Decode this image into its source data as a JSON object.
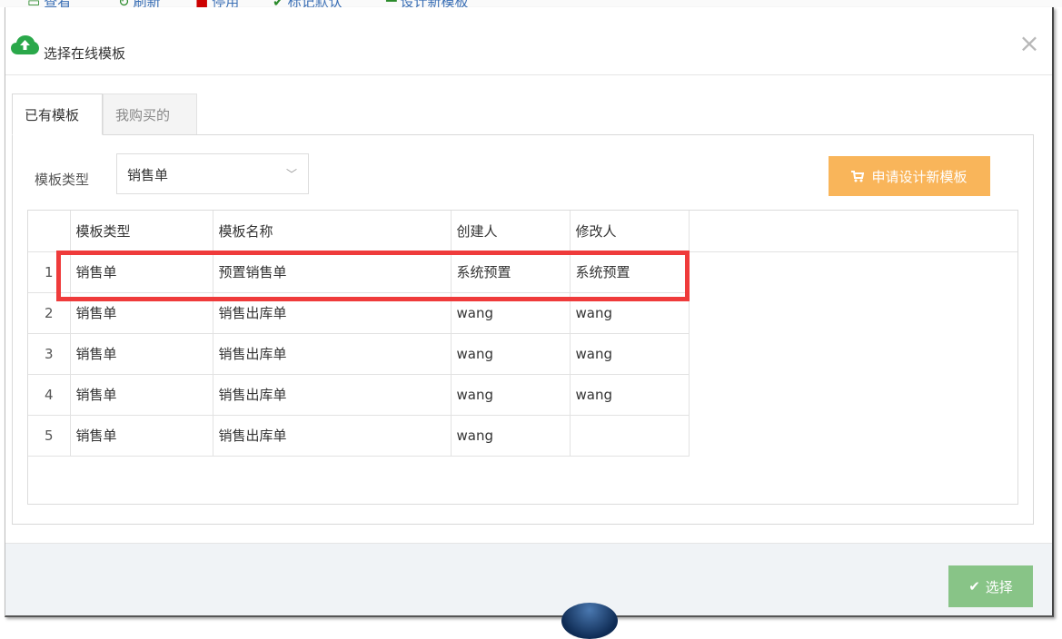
{
  "bg_toolbar": {
    "items": [
      {
        "label": "查看",
        "icon": "eye-icon"
      },
      {
        "label": "刷新",
        "icon": "refresh-icon"
      },
      {
        "label": "停用",
        "icon": "stop-icon"
      },
      {
        "label": "标记默认",
        "icon": "check-icon"
      },
      {
        "label": "设计新模板",
        "icon": "cart-icon"
      }
    ]
  },
  "modal": {
    "title": "选择在线模板",
    "title_icon": "cloud-upload-icon",
    "close_glyph": "×"
  },
  "tabs": [
    {
      "label": "已有模板",
      "active": true
    },
    {
      "label": "我购买的",
      "active": false
    }
  ],
  "filter": {
    "label": "模板类型",
    "selected": "销售单"
  },
  "apply_button": {
    "label": "申请设计新模板",
    "icon": "cart-icon"
  },
  "table": {
    "columns": [
      "模板类型",
      "模板名称",
      "创建人",
      "修改人"
    ],
    "rows": [
      {
        "no": "1",
        "type": "销售单",
        "name": "预置销售单",
        "creator": "系统预置",
        "modifier": "系统预置"
      },
      {
        "no": "2",
        "type": "销售单",
        "name": "销售出库单",
        "creator": "wang",
        "modifier": "wang"
      },
      {
        "no": "3",
        "type": "销售单",
        "name": "销售出库单",
        "creator": "wang",
        "modifier": "wang"
      },
      {
        "no": "4",
        "type": "销售单",
        "name": "销售出库单",
        "creator": "wang",
        "modifier": "wang"
      },
      {
        "no": "5",
        "type": "销售单",
        "name": "销售出库单",
        "creator": "wang",
        "modifier": ""
      }
    ]
  },
  "footer": {
    "select_label": "选择",
    "select_icon": "check-icon"
  },
  "colors": {
    "apply_button_bg": "#f9b55a",
    "select_button_bg": "#88c487",
    "highlight_border": "#ef3b3b",
    "icon_green": "#2aa84a"
  }
}
